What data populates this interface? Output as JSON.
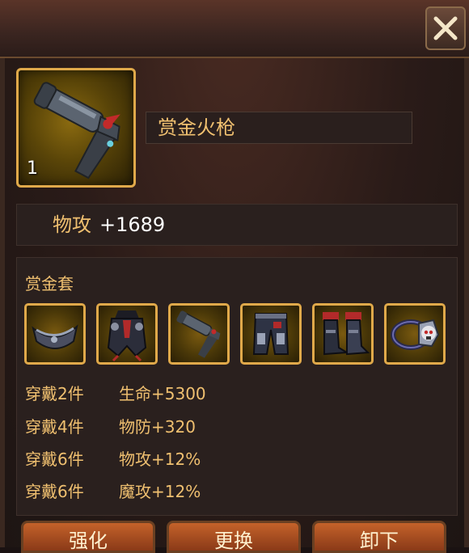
{
  "item": {
    "name": "赏金火枪",
    "count": "1"
  },
  "stat": {
    "label": "物攻",
    "value": "+1689"
  },
  "set": {
    "title": "赏金套",
    "pieces": [
      {
        "icon": "eyepatch-icon"
      },
      {
        "icon": "pirate-coat-icon"
      },
      {
        "icon": "flintlock-pistol-icon"
      },
      {
        "icon": "armored-pants-icon"
      },
      {
        "icon": "pirate-boots-icon"
      },
      {
        "icon": "skull-ring-icon"
      }
    ],
    "bonuses": [
      {
        "count": "穿戴2件",
        "effect": "生命+5300"
      },
      {
        "count": "穿戴4件",
        "effect": "物防+320"
      },
      {
        "count": "穿戴6件",
        "effect": "物攻+12%"
      },
      {
        "count": "穿戴6件",
        "effect": "魔攻+12%"
      }
    ]
  },
  "buttons": {
    "enhance": "强化",
    "replace": "更换",
    "unequip": "卸下"
  }
}
